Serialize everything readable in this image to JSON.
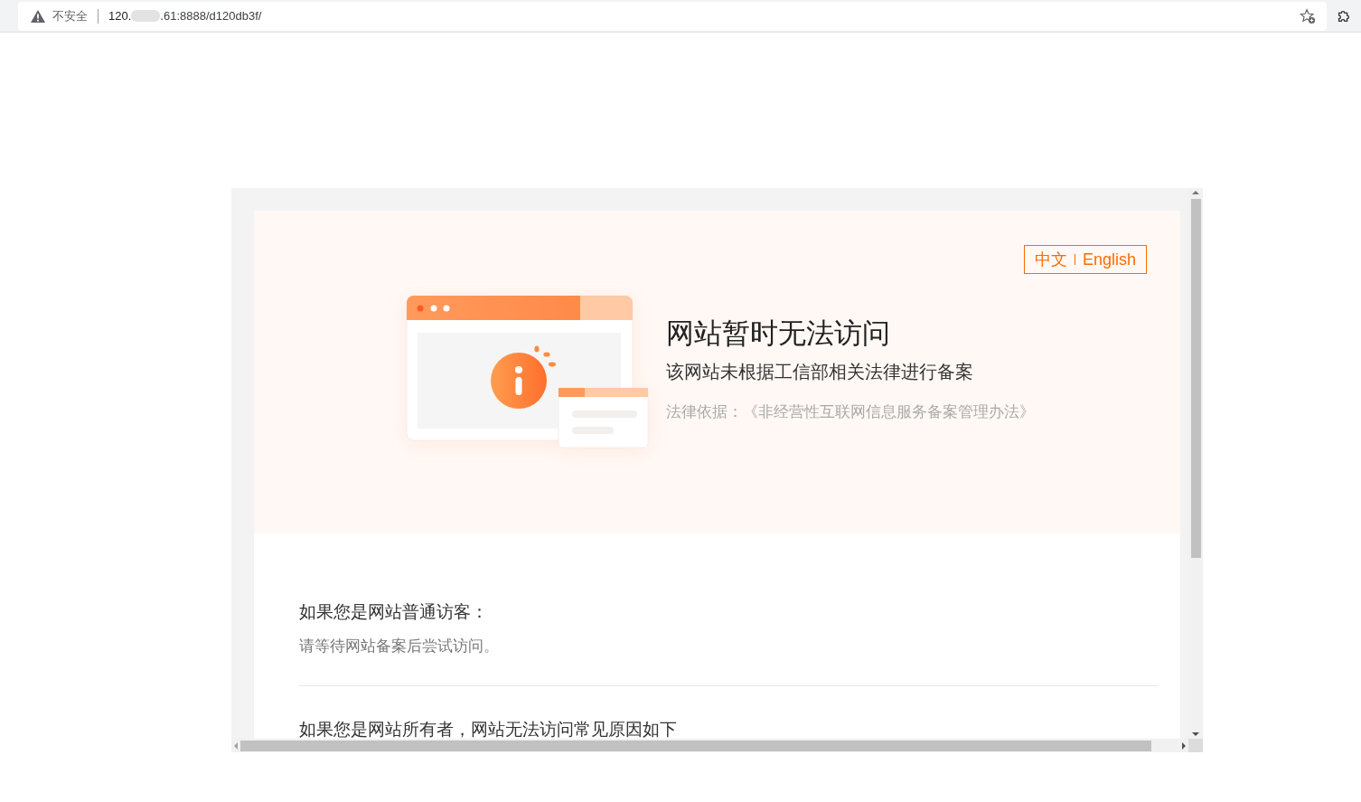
{
  "address_bar": {
    "security_label": "不安全",
    "url_start": "120.",
    "url_end": ".61:8888/d120db3f/"
  },
  "page": {
    "language_switch": [
      "中文",
      "English"
    ],
    "title": "网站暂时无法访问",
    "subtitle": "该网站未根据工信部相关法律进行备案",
    "legal_basis": "法律依据：《非经营性互联网信息服务备案管理办法》",
    "sections": [
      {
        "heading": "如果您是网站普通访客：",
        "text": "请等待网站备案后尝试访问。"
      },
      {
        "heading": "如果您是网站所有者，网站无法访问常见原因如下"
      }
    ]
  }
}
